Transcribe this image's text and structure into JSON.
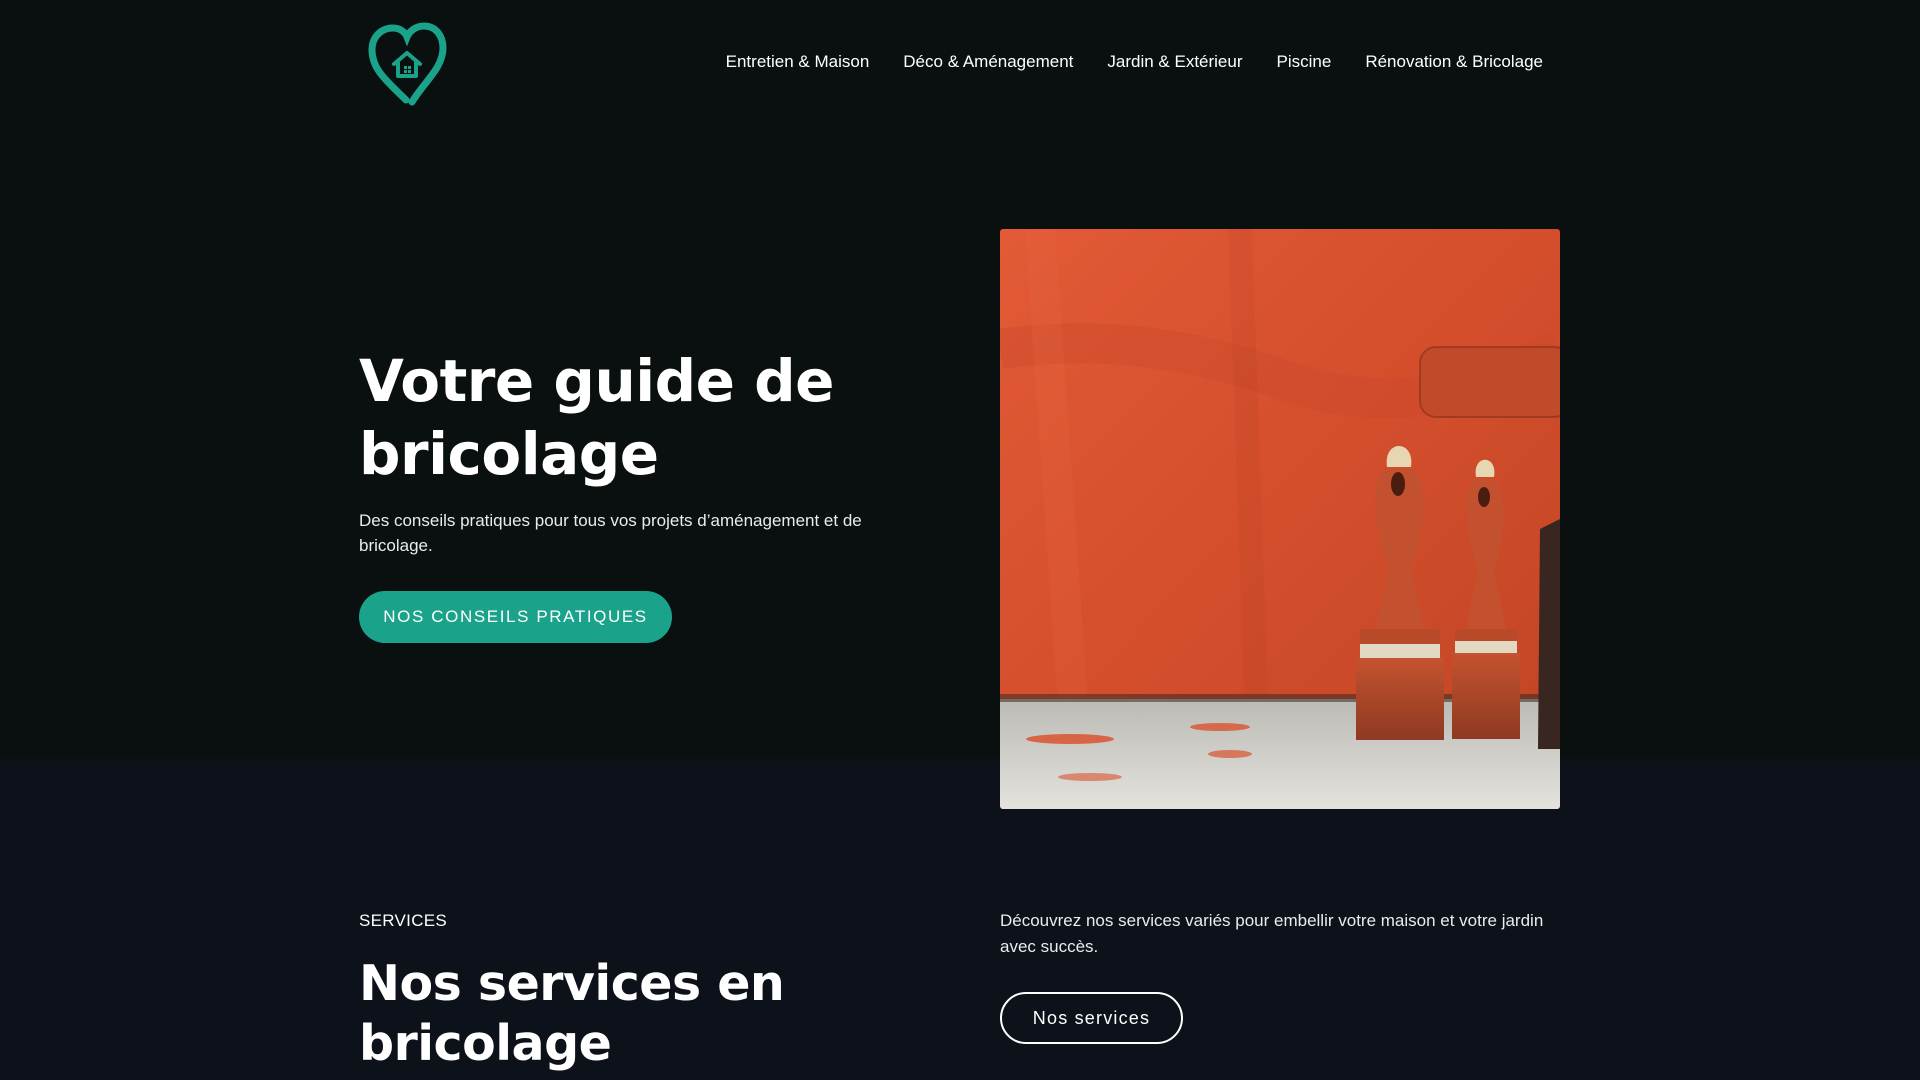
{
  "header": {
    "logo_icon": "heart-house-icon",
    "nav": [
      {
        "label": "Entretien & Maison"
      },
      {
        "label": "Déco & Aménagement"
      },
      {
        "label": "Jardin & Extérieur"
      },
      {
        "label": "Piscine"
      },
      {
        "label": "Rénovation & Bricolage"
      }
    ]
  },
  "hero": {
    "title": "Votre guide de bricolage",
    "subtitle": "Des conseils pratiques pour tous vos projets d’aménagement et de bricolage.",
    "cta_label": "NOS CONSEILS PRATIQUES",
    "image_alt": "paint-roller-and-brushes-image"
  },
  "services": {
    "eyebrow": "SERVICES",
    "title": "Nos services en bricolage",
    "description": "Découvrez nos services variés pour embellir votre maison et votre jardin avec succès.",
    "button_label": "Nos services"
  },
  "colors": {
    "accent": "#1aa38a",
    "top_background": "#0a0f10",
    "bottom_background": "#0c111a",
    "wall": "#d9502f"
  }
}
